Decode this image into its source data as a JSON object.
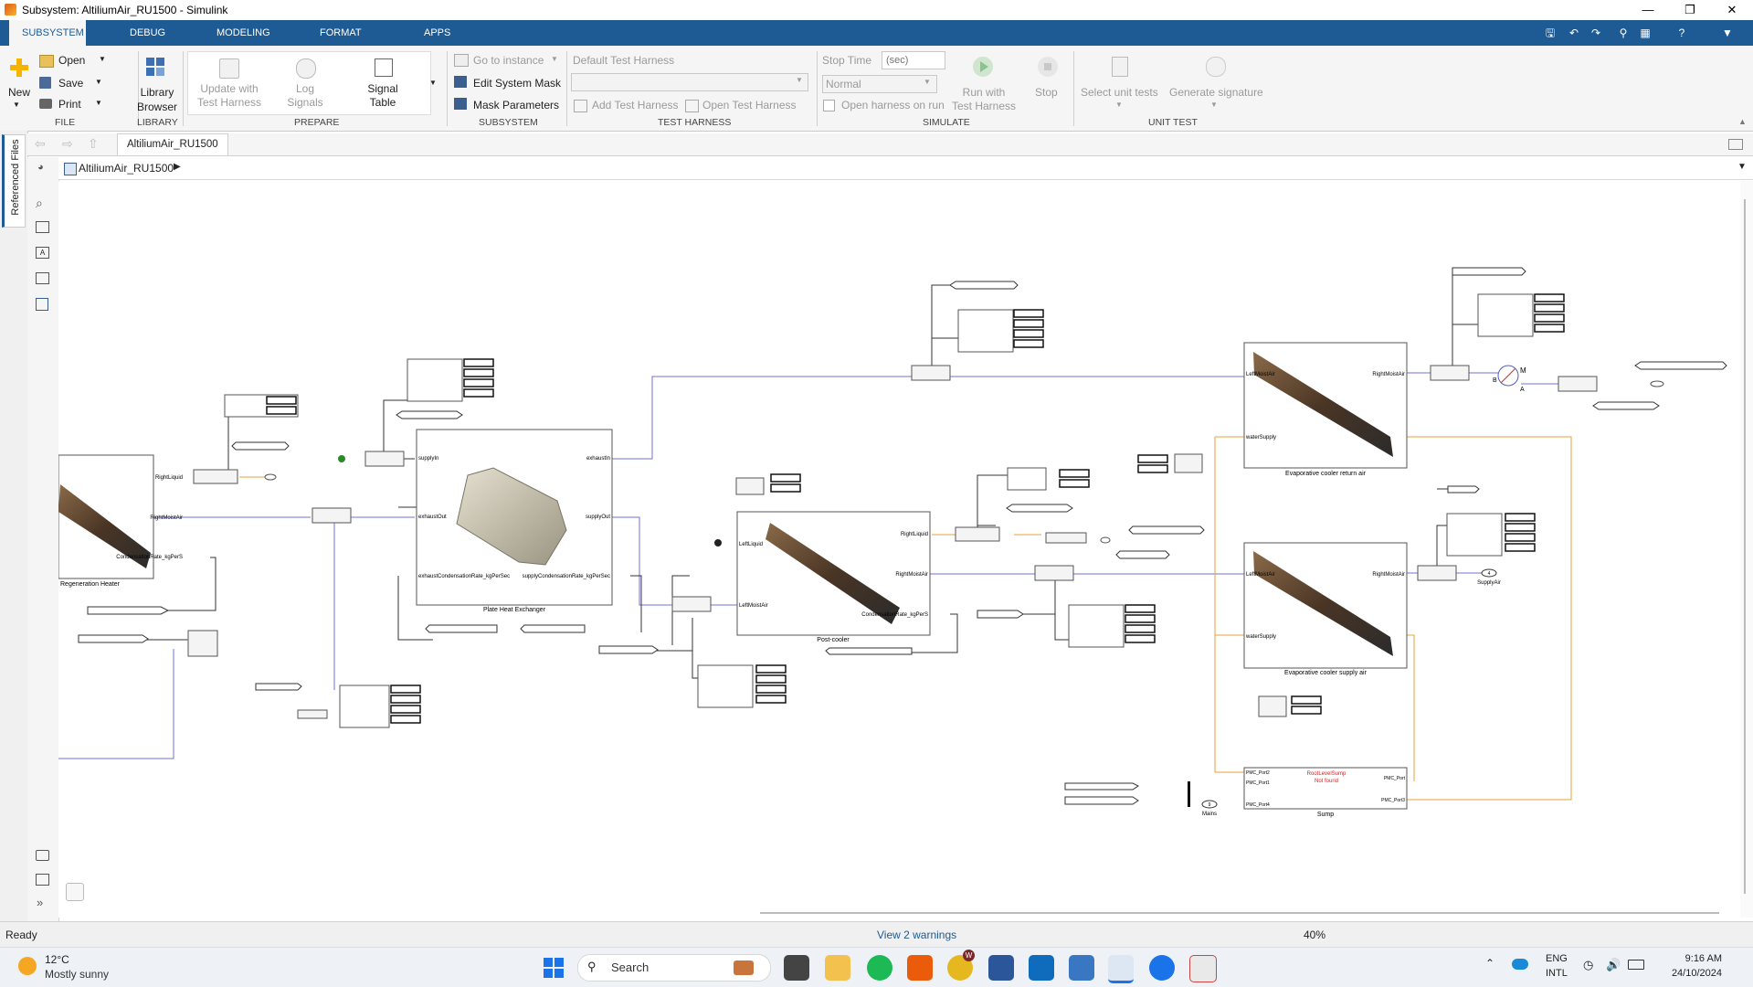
{
  "window": {
    "title": "Subsystem: AltiliumAir_RU1500 - Simulink"
  },
  "tabs": [
    {
      "label": "SUBSYSTEM",
      "active": true
    },
    {
      "label": "DEBUG"
    },
    {
      "label": "MODELING"
    },
    {
      "label": "FORMAT"
    },
    {
      "label": "APPS"
    }
  ],
  "ribbon": {
    "file": {
      "new": "New",
      "open": "Open",
      "save": "Save",
      "print": "Print",
      "group": "FILE"
    },
    "library": {
      "browser_line1": "Library",
      "browser_line2": "Browser",
      "group": "LIBRARY"
    },
    "prepare": {
      "update_line1": "Update with",
      "update_line2": "Test Harness",
      "log_line1": "Log",
      "log_line2": "Signals",
      "signal_line1": "Signal",
      "signal_line2": "Table",
      "group": "PREPARE"
    },
    "subsystem": {
      "goto": "Go to instance",
      "edit_mask": "Edit System Mask",
      "mask_params": "Mask Parameters",
      "group": "SUBSYSTEM"
    },
    "harness": {
      "default": "Default Test Harness",
      "add": "Add Test Harness",
      "open": "Open Test Harness",
      "group": "TEST HARNESS"
    },
    "simulate": {
      "stop_time_label": "Stop Time",
      "stop_time_placeholder": "(sec)",
      "mode": "Normal",
      "open_on_run": "Open harness on run",
      "run_line1": "Run with",
      "run_line2": "Test Harness",
      "stop": "Stop",
      "group": "SIMULATE"
    },
    "unittest": {
      "select": "Select unit tests",
      "generate": "Generate signature",
      "group": "UNIT TEST"
    }
  },
  "nav": {
    "tab": "AltiliumAir_RU1500"
  },
  "address": {
    "path": "AltiliumAir_RU1500"
  },
  "sidebar": {
    "label": "Referenced Files"
  },
  "diagram": {
    "blocks": {
      "regen": "Regeneration Heater",
      "phe": "Plate Heat Exchanger",
      "postcooler": "Post-cooler",
      "evap_return": "Evaporative cooler return air",
      "evap_supply": "Evaporative cooler supply air",
      "sump": "Sump",
      "mains": "Mains",
      "supply_air": "SupplyAir"
    },
    "ports": {
      "right_liquid": "RightLiquid",
      "right_moist_air": "RightMoistAir",
      "left_liquid": "LeftLiquid",
      "left_moist_air": "LeftMoistAir",
      "water_supply": "waterSupply",
      "supply_in": "supplyIn",
      "exhaust_out": "exhaustOut",
      "exhaust_in": "exhaustIn",
      "supply_out": "supplyOut",
      "exhaust_cond": "exhaustCondensationRate_kgPerSec",
      "supply_cond": "supplyCondensationRate_kgPerSec",
      "cond_rate": "CondensationRate_kgPerS",
      "pmc_port2": "PMC_Port2",
      "pmc_port1": "PMC_Port1",
      "pmc_port4": "PMC_Port4",
      "pmc_port": "PMC_Port",
      "pmc_port3": "PMC_Port3",
      "sump_error_1": "RootLevelSump",
      "sump_error_2": "Not found",
      "rotor_m": "M",
      "rotor_b": "B",
      "rotor_a": "A",
      "port_num_9": "9",
      "port_num_4": "4"
    }
  },
  "status": {
    "ready": "Ready",
    "warnings": "View 2 warnings",
    "zoom": "40%"
  },
  "taskbar": {
    "temp": "12°C",
    "weather": "Mostly sunny",
    "search": "Search",
    "lang1": "ENG",
    "lang2": "INTL",
    "time": "9:16 AM",
    "date": "24/10/2024",
    "badge_w": "W"
  },
  "colors": {
    "ribbon_blue": "#1e5a93",
    "signal_blue": "#6b6bd6",
    "signal_orange": "#e8a23a"
  }
}
